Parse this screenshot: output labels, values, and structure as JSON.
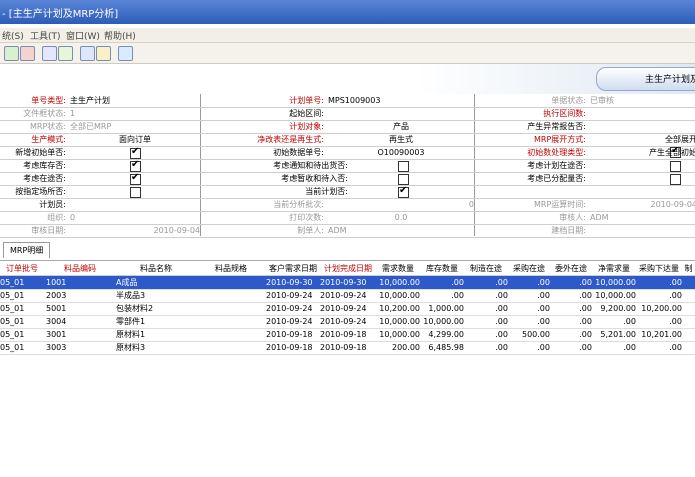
{
  "window": {
    "title": "- [主生产计划及MRP分析]"
  },
  "menu": {
    "items": [
      "统(S)",
      "工具(T)",
      "窗口(W)",
      "帮助(H)"
    ]
  },
  "banner": {
    "title": "主生产计划及"
  },
  "form": {
    "rows": [
      {
        "l1": "单号类型:",
        "v1": "主生产计划",
        "l2": "计划单号:",
        "v2": "MPS1009003",
        "l3": "单据状态:",
        "v3": "已审核"
      },
      {
        "l1": "文件框状态:",
        "v1": "1",
        "l2": "起始区间:",
        "v2": "",
        "l3": "执行区间数:",
        "v3": ""
      },
      {
        "l1": "MRP状态:",
        "v1": "全部已MRP",
        "l2": "计划对象:",
        "v2": "产品",
        "l3": "产生异常报告否:",
        "v3": ""
      },
      {
        "l1": "生产模式:",
        "v1": "面向订单",
        "l2": "净改表还是再生式:",
        "v2": "再生式",
        "l3": "MRP展开方式:",
        "v3": "全部展开"
      },
      {
        "l1": "新增初始单否:",
        "v1": "",
        "l2": "初始数据单号:",
        "v2": "O10090003",
        "l3": "初始数处理类型:",
        "v3": "产生全部初始"
      },
      {
        "l1": "考虑库存否:",
        "v1": "",
        "l2": "考虑通知和待出货否:",
        "v2": "",
        "l3": "考虑计划在途否:",
        "v3": ""
      },
      {
        "l1": "考虑在途否:",
        "v1": "",
        "l2": "考虑暂收和待入否:",
        "v2": "",
        "l3": "考虑已分配量否:",
        "v3": ""
      },
      {
        "l1": "按指定场所否:",
        "v1": "",
        "l2": "当前计划否:",
        "v2": "",
        "l3": "",
        "v3": ""
      },
      {
        "l1": "计划员:",
        "v1": "",
        "l2": "当前分析批次:",
        "v2": "0",
        "l3": "MRP运算时间:",
        "v3": "2010-09-04"
      },
      {
        "l1": "组织:",
        "v1": "0",
        "l2": "打印次数:",
        "v2": "0.0",
        "l3": "审核人:",
        "v3": "ADM"
      },
      {
        "l1": "审核日期:",
        "v1": "2010-09-04",
        "l2": "制单人:",
        "v2": "ADM",
        "l3": "建档日期:",
        "v3": ""
      }
    ]
  },
  "tabs": {
    "mrp": "MRP明细"
  },
  "table": {
    "headers": [
      "订单批号",
      "料品编码",
      "料品名称",
      "料品规格",
      "客户需求日期",
      "计划完成日期",
      "需求数量",
      "库存数量",
      "制造在途",
      "采购在途",
      "委外在途",
      "净需求量",
      "采购下达量",
      "制"
    ],
    "rows": [
      [
        "05_01",
        "1001",
        "A成品",
        "",
        "2010-09-30",
        "2010-09-30",
        "10,000.00",
        ".00",
        ".00",
        ".00",
        ".00",
        "10,000.00",
        ".00",
        ""
      ],
      [
        "05_01",
        "2003",
        "半成品3",
        "",
        "2010-09-24",
        "2010-09-24",
        "10,000.00",
        ".00",
        ".00",
        ".00",
        ".00",
        "10,000.00",
        ".00",
        ""
      ],
      [
        "05_01",
        "5001",
        "包装材料2",
        "",
        "2010-09-24",
        "2010-09-24",
        "10,200.00",
        "1,000.00",
        ".00",
        ".00",
        ".00",
        "9,200.00",
        "10,200.00",
        ""
      ],
      [
        "05_01",
        "3004",
        "零部件1",
        "",
        "2010-09-24",
        "2010-09-24",
        "10,000.00",
        "10,000.00",
        ".00",
        ".00",
        ".00",
        ".00",
        ".00",
        ""
      ],
      [
        "05_01",
        "3001",
        "原材料1",
        "",
        "2010-09-18",
        "2010-09-18",
        "10,000.00",
        "4,299.00",
        ".00",
        "500.00",
        ".00",
        "5,201.00",
        "10,201.00",
        ""
      ],
      [
        "05_01",
        "3003",
        "原材料3",
        "",
        "2010-09-18",
        "2010-09-18",
        "200.00",
        "6,485.98",
        ".00",
        ".00",
        ".00",
        ".00",
        ".00",
        ""
      ]
    ]
  },
  "colors": {
    "selection": "#2e59c8",
    "label_red": "#c00000",
    "titlebar": "#2c5cb8"
  }
}
